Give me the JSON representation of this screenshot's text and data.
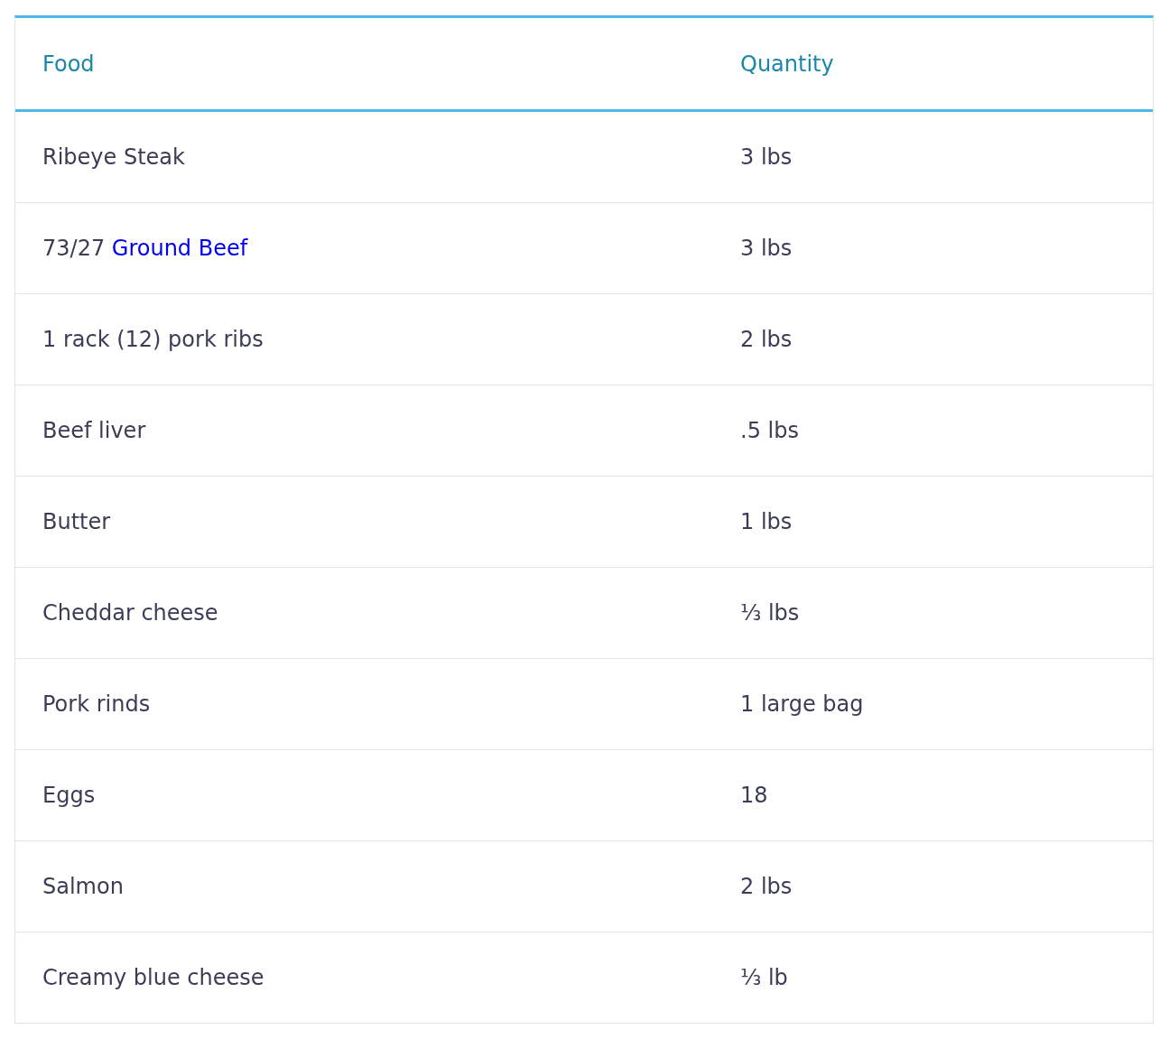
{
  "table": {
    "columns": [
      "Food",
      "Quantity"
    ],
    "rows": [
      {
        "food": "Ribeye Steak",
        "quantity": "3 lbs"
      },
      {
        "food": "73/27",
        "food_link": "Ground Beef",
        "quantity": "3 lbs"
      },
      {
        "food": "1 rack (12) pork ribs",
        "quantity": "2 lbs"
      },
      {
        "food": "Beef liver",
        "quantity": ".5 lbs"
      },
      {
        "food": "Butter",
        "quantity": "1 lbs"
      },
      {
        "food": "Cheddar cheese",
        "quantity": "⅓ lbs"
      },
      {
        "food": "Pork rinds",
        "quantity": "1 large bag"
      },
      {
        "food": "Eggs",
        "quantity": "18"
      },
      {
        "food": "Salmon",
        "quantity": "2 lbs"
      },
      {
        "food": "Creamy blue cheese",
        "quantity": "⅓ lb"
      }
    ]
  }
}
